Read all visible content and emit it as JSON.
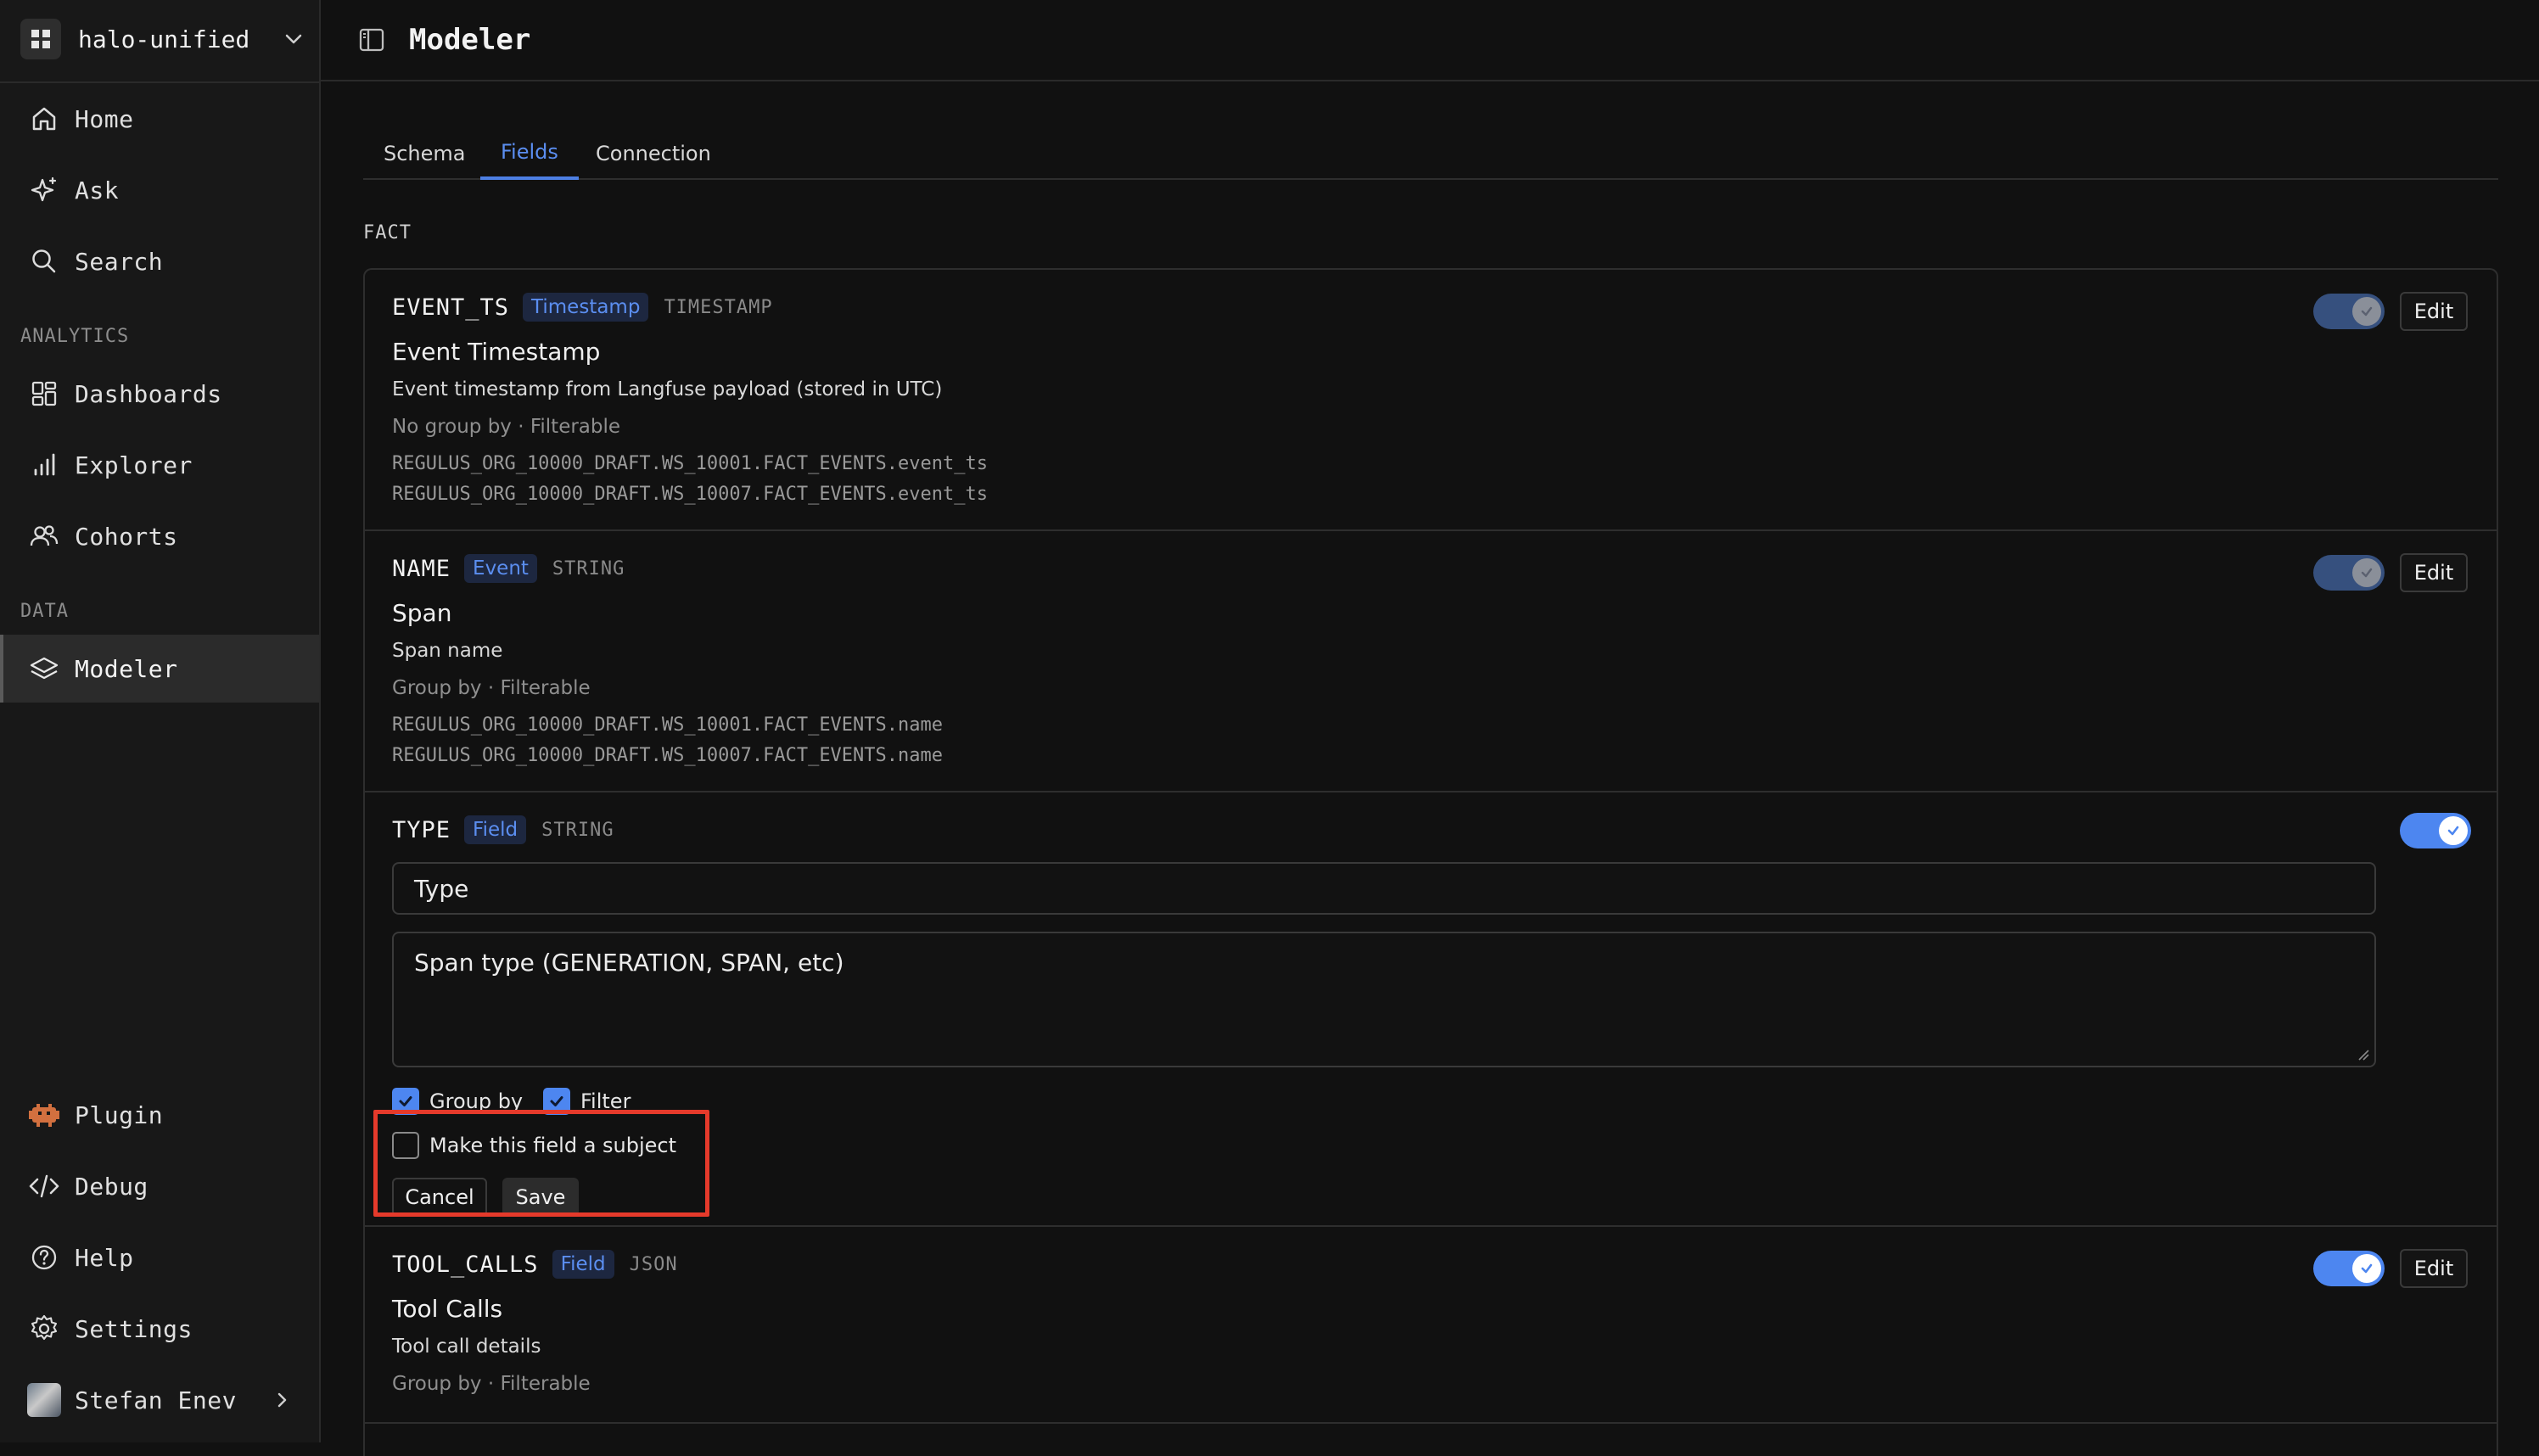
{
  "workspace": {
    "name": "halo-unified"
  },
  "nav": {
    "home": "Home",
    "ask": "Ask",
    "search": "Search",
    "analytics_label": "ANALYTICS",
    "dashboards": "Dashboards",
    "explorer": "Explorer",
    "cohorts": "Cohorts",
    "data_label": "DATA",
    "modeler": "Modeler",
    "plugin": "Plugin",
    "debug": "Debug",
    "help": "Help",
    "settings": "Settings",
    "user": "Stefan Enev"
  },
  "header": {
    "title": "Modeler"
  },
  "tabs": [
    {
      "label": "Schema",
      "active": false
    },
    {
      "label": "Fields",
      "active": true
    },
    {
      "label": "Connection",
      "active": false
    }
  ],
  "section": {
    "title": "FACT"
  },
  "fields": [
    {
      "key": "EVENT_TS",
      "badge": "Timestamp",
      "type": "TIMESTAMP",
      "display_name": "Event Timestamp",
      "description": "Event timestamp from Langfuse payload (stored in UTC)",
      "meta": "No group by · Filterable",
      "paths": [
        "REGULUS_ORG_10000_DRAFT.WS_10001.FACT_EVENTS.event_ts",
        "REGULUS_ORG_10000_DRAFT.WS_10007.FACT_EVENTS.event_ts"
      ],
      "enabled": true,
      "edit_label": "Edit"
    },
    {
      "key": "NAME",
      "badge": "Event",
      "type": "STRING",
      "display_name": "Span",
      "description": "Span name",
      "meta": "Group by · Filterable",
      "paths": [
        "REGULUS_ORG_10000_DRAFT.WS_10001.FACT_EVENTS.name",
        "REGULUS_ORG_10000_DRAFT.WS_10007.FACT_EVENTS.name"
      ],
      "enabled": true,
      "edit_label": "Edit"
    },
    {
      "key": "TYPE",
      "badge": "Field",
      "type": "STRING",
      "editing": true,
      "name_value": "Type",
      "description_value": "Span type (GENERATION, SPAN, etc)",
      "group_by_label": "Group by",
      "group_by_checked": true,
      "filter_label": "Filter",
      "filter_checked": true,
      "subject_label": "Make this field a subject",
      "subject_checked": false,
      "cancel_label": "Cancel",
      "save_label": "Save",
      "enabled": true
    },
    {
      "key": "TOOL_CALLS",
      "badge": "Field",
      "type": "JSON",
      "display_name": "Tool Calls",
      "description": "Tool call details",
      "meta": "Group by · Filterable",
      "enabled": true,
      "edit_label": "Edit"
    }
  ],
  "colors": {
    "accent": "#4d86f0",
    "highlight": "#e53a2b",
    "background": "#111111",
    "sidebar": "#181818"
  }
}
